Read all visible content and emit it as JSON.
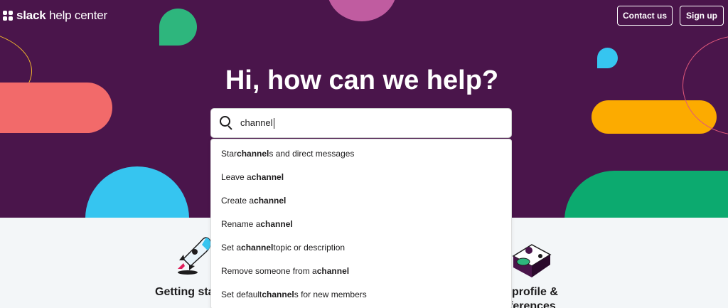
{
  "header": {
    "logo_bold": "slack",
    "logo_rest": " help center",
    "contact_label": "Contact us",
    "signup_label": "Sign up"
  },
  "hero": {
    "title": "Hi, how can we help?"
  },
  "search": {
    "value": "channel",
    "icon": "search-icon"
  },
  "suggestions": [
    {
      "before": "Star ",
      "match": "channel",
      "after": "s and direct messages"
    },
    {
      "before": "Leave a ",
      "match": "channel",
      "after": ""
    },
    {
      "before": "Create a ",
      "match": "channel",
      "after": ""
    },
    {
      "before": "Rename a ",
      "match": "channel",
      "after": ""
    },
    {
      "before": "Set a ",
      "match": "channel",
      "after": " topic or description"
    },
    {
      "before": "Remove someone from a ",
      "match": "channel",
      "after": ""
    },
    {
      "before": "Set default ",
      "match": "channel",
      "after": "s for new members"
    }
  ],
  "cards": {
    "left_label": "Getting sta",
    "right_label_line1": "profile &",
    "right_label_line2": "ferences"
  },
  "colors": {
    "hero_bg": "#4a154b",
    "green": "#2eb67d",
    "blue": "#36c5f0",
    "coral": "#f26a6a",
    "orange": "#fcab00",
    "pink": "#c05ca0"
  }
}
